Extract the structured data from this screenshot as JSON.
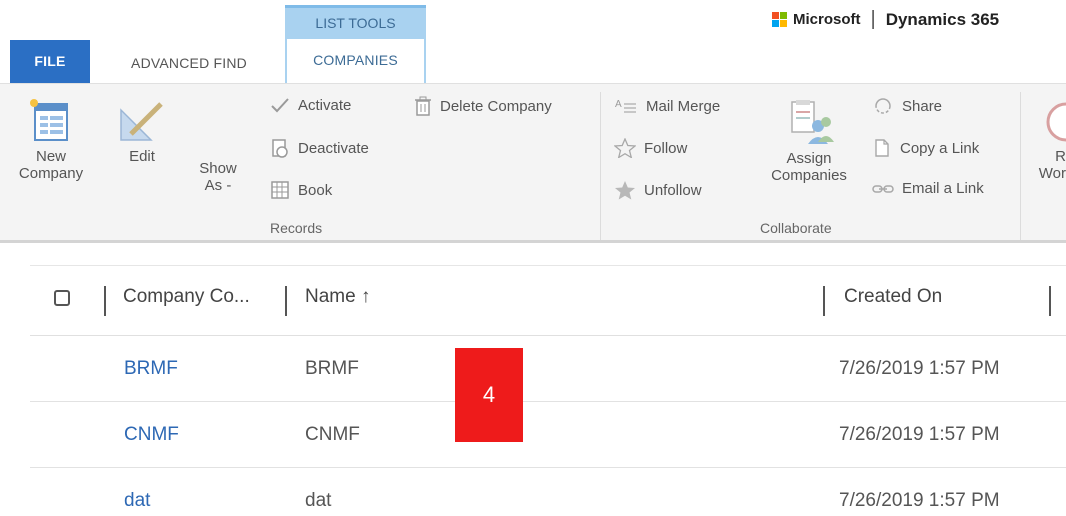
{
  "brand": {
    "company": "Microsoft",
    "separator": "|",
    "product": "Dynamics 365",
    "logo_colors": [
      "#f25022",
      "#7fba00",
      "#00a4ef",
      "#ffb900"
    ]
  },
  "tabs": {
    "file": "FILE",
    "advanced_find": "ADVANCED FIND",
    "contextual_header": "LIST TOOLS",
    "companies": "COMPANIES"
  },
  "ribbon": {
    "records": {
      "new_company": [
        "New",
        "Company"
      ],
      "edit": "Edit",
      "show_as": [
        "Show",
        "As -"
      ],
      "activate": "Activate",
      "deactivate": "Deactivate",
      "book": "Book",
      "delete_company": "Delete Company",
      "group_label": "Records"
    },
    "collaborate": {
      "mail_merge": "Mail Merge",
      "follow": "Follow",
      "unfollow": "Unfollow",
      "assign_companies": [
        "Assign",
        "Companies"
      ],
      "share": "Share",
      "copy_a_link": "Copy a Link",
      "email_a_link": "Email a Link",
      "group_label": "Collaborate"
    },
    "partial": [
      "R",
      "Wor"
    ]
  },
  "grid": {
    "columns": {
      "company_code": "Company Co...",
      "name": "Name ↑",
      "created_on": "Created On"
    },
    "rows": [
      {
        "code": "BRMF",
        "name": "BRMF",
        "created_on": "7/26/2019 1:57 PM"
      },
      {
        "code": "CNMF",
        "name": "CNMF",
        "created_on": "7/26/2019 1:57 PM"
      },
      {
        "code": "dat",
        "name": "dat",
        "created_on": "7/26/2019 1:57 PM"
      }
    ]
  },
  "annotation": {
    "label": "4",
    "color": "#ee1b1b"
  },
  "colors": {
    "file_tab": "#2b6fc4",
    "contextual_tab": "#a9d2f0",
    "link": "#2d68b4"
  }
}
